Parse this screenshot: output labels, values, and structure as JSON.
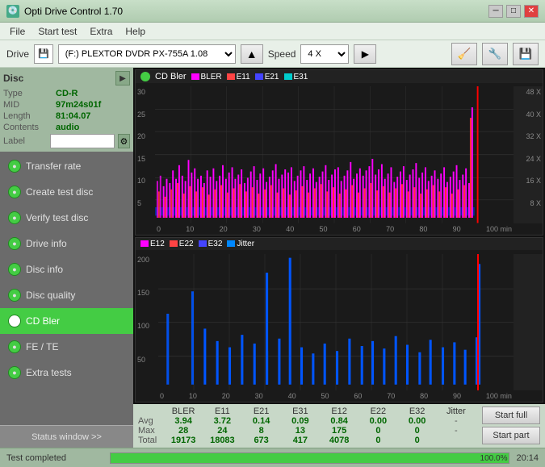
{
  "titlebar": {
    "title": "Opti Drive Control 1.70",
    "icon": "🔵",
    "btn_min": "─",
    "btn_max": "□",
    "btn_close": "✕"
  },
  "menubar": {
    "items": [
      "File",
      "Start test",
      "Extra",
      "Help"
    ]
  },
  "drivebar": {
    "drive_label": "Drive",
    "drive_value": "(F:)  PLEXTOR DVDR  PX-755A 1.08",
    "speed_label": "Speed",
    "speed_value": "4 X",
    "eject_icon": "▲"
  },
  "disc": {
    "title": "Disc",
    "type_label": "Type",
    "type_value": "CD-R",
    "mid_label": "MID",
    "mid_value": "97m24s01f",
    "length_label": "Length",
    "length_value": "81:04.07",
    "contents_label": "Contents",
    "contents_value": "audio",
    "label_label": "Label"
  },
  "nav": {
    "items": [
      {
        "label": "Transfer rate",
        "active": false
      },
      {
        "label": "Create test disc",
        "active": false
      },
      {
        "label": "Verify test disc",
        "active": false
      },
      {
        "label": "Drive info",
        "active": false
      },
      {
        "label": "Disc info",
        "active": false
      },
      {
        "label": "Disc quality",
        "active": false
      },
      {
        "label": "CD Bler",
        "active": true
      },
      {
        "label": "FE / TE",
        "active": false
      },
      {
        "label": "Extra tests",
        "active": false
      }
    ],
    "status_window": "Status window >>"
  },
  "chart1": {
    "title": "CD Bler",
    "legends": [
      {
        "label": "BLER",
        "color": "#ff00ff"
      },
      {
        "label": "E11",
        "color": "#ff0000"
      },
      {
        "label": "E21",
        "color": "#0000ff"
      },
      {
        "label": "E31",
        "color": "#00ffff"
      }
    ],
    "y_labels": [
      "30",
      "25",
      "20",
      "15",
      "10",
      "5",
      ""
    ],
    "y_right": [
      "48 X",
      "40 X",
      "32 X",
      "24 X",
      "16 X",
      "8 X",
      ""
    ],
    "x_labels": [
      "0",
      "10",
      "20",
      "30",
      "40",
      "50",
      "60",
      "70",
      "80",
      "90",
      "100 min"
    ]
  },
  "chart2": {
    "legends": [
      {
        "label": "E12",
        "color": "#ff00ff"
      },
      {
        "label": "E22",
        "color": "#ff0000"
      },
      {
        "label": "E32",
        "color": "#0000ff"
      },
      {
        "label": "Jitter",
        "color": "#00aaff"
      }
    ],
    "y_labels": [
      "200",
      "150",
      "100",
      "50",
      ""
    ],
    "y_right": [
      "",
      "",
      "",
      "",
      ""
    ],
    "x_labels": [
      "0",
      "10",
      "20",
      "30",
      "40",
      "50",
      "60",
      "70",
      "80",
      "90",
      "100 min"
    ]
  },
  "stats": {
    "headers": [
      "",
      "BLER",
      "E11",
      "E21",
      "E31",
      "E12",
      "E22",
      "E32",
      "Jitter"
    ],
    "avg": [
      "Avg",
      "3.94",
      "3.72",
      "0.14",
      "0.09",
      "0.84",
      "0.00",
      "0.00",
      "-"
    ],
    "max": [
      "Max",
      "28",
      "24",
      "8",
      "13",
      "175",
      "0",
      "0",
      "-"
    ],
    "total": [
      "Total",
      "19173",
      "18083",
      "673",
      "417",
      "4078",
      "0",
      "0",
      ""
    ]
  },
  "buttons": {
    "start_full": "Start full",
    "start_part": "Start part"
  },
  "statusbar": {
    "text": "Test completed",
    "progress": 100,
    "progress_text": "100.0%",
    "time": "20:14"
  },
  "colors": {
    "accent_green": "#44cc44",
    "sidebar_bg": "#6b6b6b",
    "disc_panel": "#a0b8a0"
  }
}
